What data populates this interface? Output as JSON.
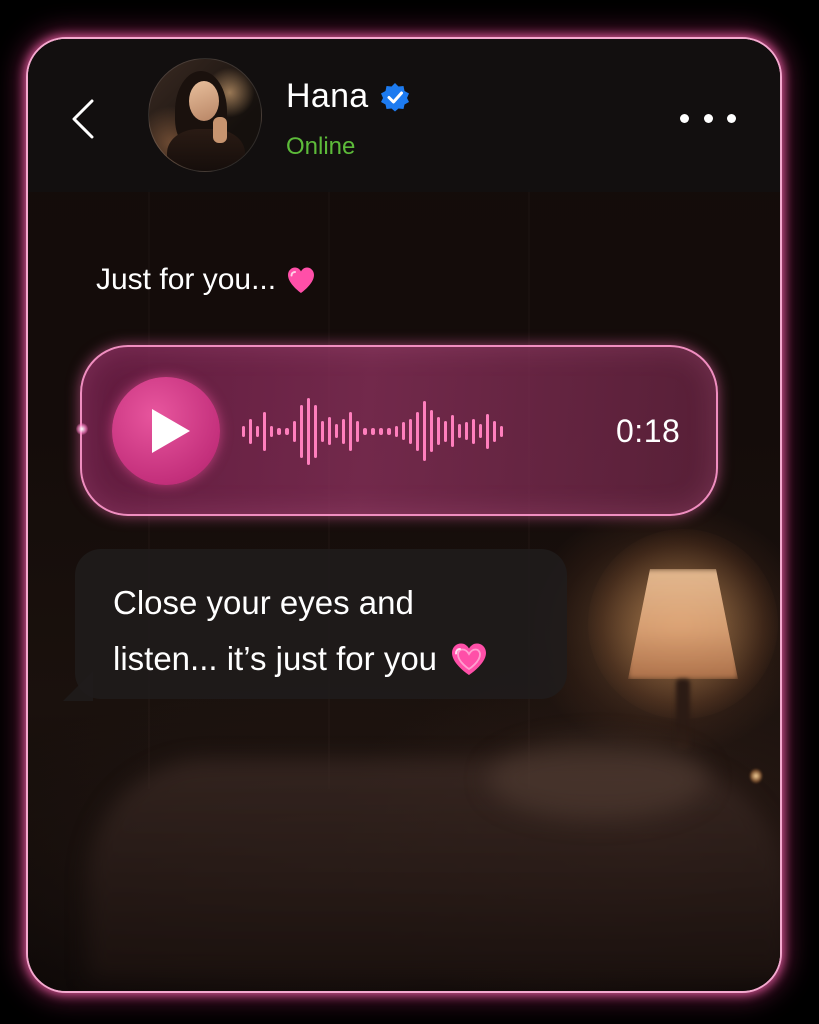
{
  "header": {
    "contact_name": "Hana",
    "status": "Online",
    "icons": {
      "back": "chevron-left-icon",
      "verified": "verified-badge-icon",
      "more": "more-options-icon"
    }
  },
  "messages": {
    "caption": "Just for you...",
    "caption_emoji": "heart-icon",
    "voice_note": {
      "duration": "0:18",
      "icon": "play-icon",
      "waveform_levels": [
        0.15,
        0.35,
        0.15,
        0.55,
        0.15,
        0.1,
        0.1,
        0.3,
        0.75,
        0.95,
        0.75,
        0.3,
        0.4,
        0.2,
        0.35,
        0.55,
        0.3,
        0.1,
        0.1,
        0.1,
        0.1,
        0.15,
        0.25,
        0.35,
        0.55,
        0.85,
        0.6,
        0.4,
        0.3,
        0.45,
        0.2,
        0.25,
        0.35,
        0.2,
        0.5,
        0.3,
        0.15
      ],
      "bubble_color": "#8a2a5e",
      "waveform_color": "#ff7fbd"
    },
    "text_message": {
      "line1": "Close your eyes and",
      "line2": "listen... it’s just for you",
      "emoji": "heart-icon"
    }
  },
  "colors": {
    "frame_glow": "#ff69b4",
    "status_green": "#5dbb3a",
    "verified_blue": "#1d7bf0",
    "play_button": "#c4307c"
  }
}
